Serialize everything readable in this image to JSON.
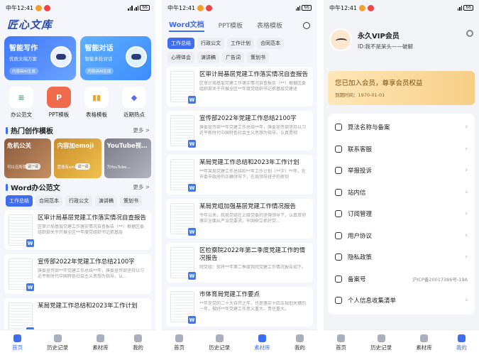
{
  "status": {
    "time": "中午12:41",
    "battery": "66"
  },
  "home": {
    "logo": "匠心文库",
    "hero": [
      {
        "title": "智能写作",
        "sub": "优质文稿方案",
        "tag": "内容由AI生成"
      },
      {
        "title": "智能对话",
        "sub": "智能多轮对话",
        "tag": "内容由AI生成"
      }
    ],
    "grid": [
      "办公范文",
      "PPT模板",
      "表格模板",
      "近期热点"
    ],
    "hot_title": "热门创作模板",
    "more": "更多 >",
    "hot": [
      {
        "title": "危机公关",
        "sub": "可以召所我…",
        "pill": "试一试"
      },
      {
        "title": "内容加emoji",
        "sub": "营造有emoji",
        "pill": "试一试"
      },
      {
        "title": "YouTube视…",
        "sub": "为YouTube…",
        "pill": ""
      }
    ],
    "word_title": "Word办公范文",
    "chips": [
      "工作总结",
      "合同范本",
      "行政公文",
      "演讲稿",
      "策划书"
    ],
    "docs": [
      {
        "title": "区审计局基层党建工作落实情况自查报告",
        "desc": "区审计局基层党建工作落实情况自查报告（**）根据区委组织部关于开展全区**年度党组织书记抓基层"
      },
      {
        "title": "宣传部2022年党建工作总结2100字",
        "desc": "旗委宣传部**年党建工作总结**年，旗委宣传部坚持以习近平新时代中国特色社会主义思想为指导，认…"
      },
      {
        "title": "某局党建工作总结和2023年工作计划",
        "desc": ""
      }
    ]
  },
  "library": {
    "tabs": [
      "Word文档",
      "PPT模板",
      "表格模板"
    ],
    "chips": [
      "工作总结",
      "行政公文",
      "工作计划",
      "合同范本",
      "心得体会",
      "演讲稿",
      "广告词",
      "策划书"
    ],
    "docs": [
      {
        "title": "区审计局基层党建工作落实情况自查报告",
        "desc": "区审计局基层党建工作落实情况自查报告（**）根据区委组织部关于开展全区**年度党组织书记抓基层党建述"
      },
      {
        "title": "宣传部2022年党建工作总结2100字",
        "desc": "旗委宣传部**年党建工作总结**年，旗委宣传部坚持以习近平新时代中国特色社会主义思想为指导，认真贯彻"
      },
      {
        "title": "某局党建工作总结和2023年工作计划",
        "desc": "**年某局党建工作总结和**年工作计划（**字）**年，在市委市政府的正确领导下，在局领导班子的密切"
      },
      {
        "title": "某局党组加强基层党建工作情况报告",
        "desc": "今年以来，我局党组在上级党委的坚强领导下，认真贯彻落实全面从严治党要求，牢固树立抓好党…"
      },
      {
        "title": "区检察院2022年第二季度党建工作的情况报告",
        "desc": "院党组：现将**年第二季度我院党建工作情况报告如下。"
      },
      {
        "title": "市体育局党建工作要点",
        "desc": "**年是党的二十大召开之年，也是落实十四五规划关键的一年，做好**年党建工作意义重大、责任重大。"
      }
    ]
  },
  "profile": {
    "name": "永久VIP会员",
    "id": "ID:我不是呆头——破解",
    "vip_title": "您已加入会员，尊享会员权益",
    "vip_sub": "到期时间：1970-01-01",
    "menu": [
      {
        "label": "算法名称与备案",
        "extra": ""
      },
      {
        "label": "联系客服",
        "extra": ""
      },
      {
        "label": "举报投诉",
        "extra": ""
      },
      {
        "label": "站内信",
        "extra": ""
      },
      {
        "label": "订阅管理",
        "extra": ""
      },
      {
        "label": "用户协议",
        "extra": ""
      },
      {
        "label": "隐私政策",
        "extra": ""
      },
      {
        "label": "备案号",
        "extra": "沪ICP备20017386号-19A"
      },
      {
        "label": "个人信息收集清单",
        "extra": ""
      }
    ]
  },
  "tabbar": [
    "首页",
    "历史记录",
    "素材库",
    "我的"
  ],
  "colors": {
    "accent": "#3f6df0",
    "vip": "#f6cf86"
  }
}
